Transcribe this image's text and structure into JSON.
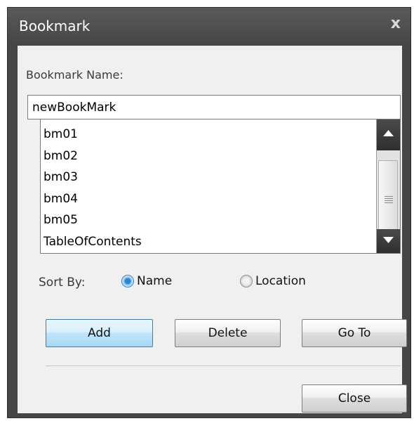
{
  "window": {
    "title": "Bookmark",
    "close_glyph": "x"
  },
  "form": {
    "name_label": "Bookmark Name:",
    "name_value": "newBookMark"
  },
  "bookmarks": [
    "bm01",
    "bm02",
    "bm03",
    "bm04",
    "bm05",
    "TableOfContents"
  ],
  "sort": {
    "label": "Sort By:",
    "options": [
      {
        "label": "Name",
        "selected": true
      },
      {
        "label": "Location",
        "selected": false
      }
    ]
  },
  "buttons": {
    "add": "Add",
    "delete": "Delete",
    "goto": "Go To",
    "close": "Close"
  },
  "colors": {
    "titlebar": "#464646",
    "client": "#f0f0f0",
    "radio_selected": "#2e86d9",
    "default_button": "#bee6fd"
  },
  "icons": {
    "scroll_up": "triangle-up-icon",
    "scroll_down": "triangle-down-icon",
    "close": "close-icon",
    "scroll_grip": "grip-lines-icon"
  }
}
